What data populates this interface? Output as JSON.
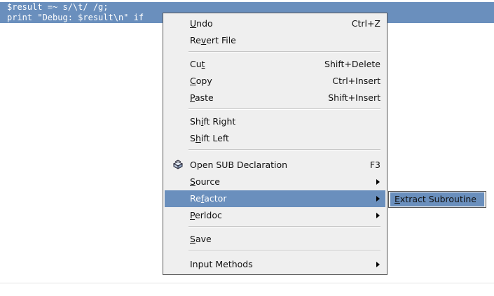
{
  "editor": {
    "lines": [
      "$result =~ s/\\t/ /g;",
      "print \"Debug: $result\\n\" if"
    ]
  },
  "menu": {
    "undo": {
      "label": "Undo",
      "mnemonic": "U",
      "accel": "Ctrl+Z"
    },
    "revert": {
      "label": "Revert File",
      "mnemonic": "v"
    },
    "cut": {
      "label": "Cut",
      "mnemonic": "t",
      "accel": "Shift+Delete"
    },
    "copy": {
      "label": "Copy",
      "mnemonic": "C",
      "accel": "Ctrl+Insert"
    },
    "paste": {
      "label": "Paste",
      "mnemonic": "P",
      "accel": "Shift+Insert"
    },
    "shift_right": {
      "label": "Shift Right",
      "mnemonic": "i"
    },
    "shift_left": {
      "label": "Shift Left",
      "mnemonic": "h"
    },
    "open_sub": {
      "label": "Open SUB Declaration",
      "accel": "F3",
      "icon": "open-declaration-icon"
    },
    "source": {
      "label": "Source",
      "mnemonic": "S"
    },
    "refactor": {
      "label": "Refactor",
      "mnemonic": "f",
      "highlighted": true
    },
    "perldoc": {
      "label": "Perldoc",
      "mnemonic": "P"
    },
    "save": {
      "label": "Save",
      "mnemonic": "S"
    },
    "input_methods": {
      "label": "Input Methods"
    }
  },
  "submenu": {
    "extract": {
      "label": "Extract Subroutine",
      "mnemonic": "E"
    }
  },
  "colors": {
    "highlight": "#6a8fbd",
    "menu_bg": "#efefef",
    "editor_bg": "#ffffff"
  }
}
